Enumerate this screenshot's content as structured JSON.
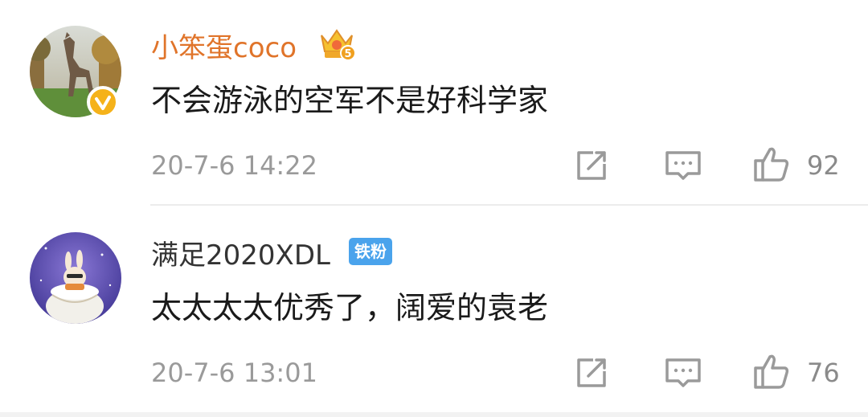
{
  "comments": [
    {
      "username": "小笨蛋coco",
      "username_color": "#e0742a",
      "avatar": "giraffe-sculpture-avatar",
      "verified": true,
      "badge_icon": "crown-level-icon",
      "badge_level": "5",
      "content": "不会游泳的空军不是好科学家",
      "time": "20-7-6 14:22",
      "likes": "92"
    },
    {
      "username": "满足2020XDL",
      "username_color": "#333333",
      "avatar": "rabbit-cake-avatar",
      "badge_text": "铁粉",
      "content": "太太太太优秀了，阔爱的袁老",
      "time": "20-7-6 13:01",
      "likes": "76"
    }
  ],
  "icons": {
    "repost": "repost-icon",
    "comment": "comment-icon",
    "like": "thumbs-up-icon",
    "verified": "verified-check-icon"
  },
  "colors": {
    "verified_badge": "#f5b21a",
    "fan_badge": "#4aa3ec",
    "icon_gray": "#9a9a9a"
  }
}
